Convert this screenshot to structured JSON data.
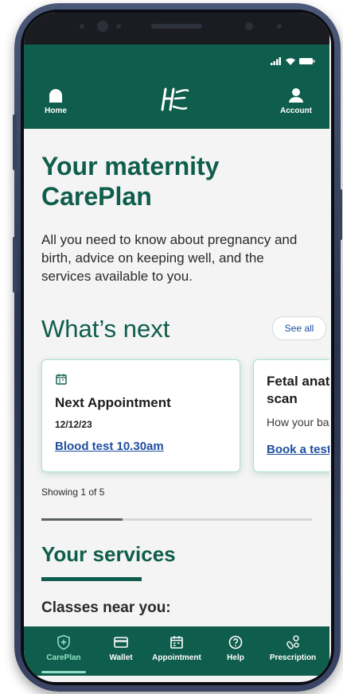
{
  "header": {
    "home_label": "Home",
    "logo_text": "HSE",
    "account_label": "Account"
  },
  "main": {
    "title": "Your maternity CarePlan",
    "intro": "All you need to know about pregnancy and birth, advice on keeping well, and the services available to you.",
    "whats_next": {
      "heading": "What’s next",
      "see_all": "See all",
      "cards": [
        {
          "title": "Next Appointment",
          "date": "12/12/23",
          "link": "Blood test 10.30am"
        },
        {
          "title": "Fetal anatomy scan",
          "subtitle": "How your baby is",
          "link": "Book a test"
        }
      ],
      "showing": "Showing 1 of 5",
      "progress_fraction": 0.3
    },
    "services": {
      "heading": "Your services",
      "classes": "Classes near you:"
    }
  },
  "tabbar": {
    "items": [
      {
        "label": "CarePlan",
        "icon": "shield-plus-icon",
        "active": true
      },
      {
        "label": "Wallet",
        "icon": "card-icon",
        "active": false
      },
      {
        "label": "Appointment",
        "icon": "calendar-icon",
        "active": false
      },
      {
        "label": "Help",
        "icon": "question-icon",
        "active": false
      },
      {
        "label": "Prescription",
        "icon": "pills-icon",
        "active": false
      }
    ]
  },
  "colors": {
    "brand": "#0f5d4c",
    "accent": "#8ee0c6",
    "link": "#1f4fa0"
  }
}
